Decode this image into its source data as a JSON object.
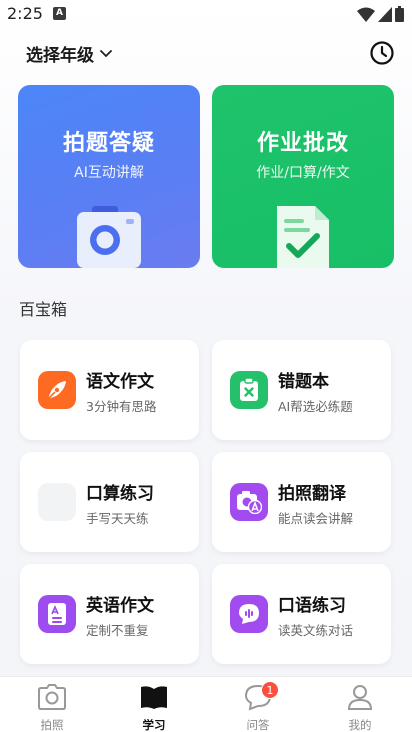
{
  "status_bar": {
    "time": "2:25",
    "app_indicator": "A"
  },
  "header": {
    "grade_label": "选择年级",
    "history_icon": "clock-icon"
  },
  "hero_cards": [
    {
      "title": "拍题答疑",
      "subtitle": "AI互动讲解",
      "color": "#5b7ef4",
      "icon": "camera-icon"
    },
    {
      "title": "作业批改",
      "subtitle": "作业/口算/作文",
      "color": "#1ac168",
      "icon": "checklist-icon"
    }
  ],
  "section": {
    "title": "百宝箱"
  },
  "tools": [
    {
      "name": "语文作文",
      "desc": "3分钟有思路",
      "icon": "pen-nib-icon",
      "color": "#ff6a22"
    },
    {
      "name": "错题本",
      "desc": "AI帮选必练题",
      "icon": "clipboard-x-icon",
      "color": "#24c06a"
    },
    {
      "name": "口算练习",
      "desc": "手写天天练",
      "icon": "placeholder-icon",
      "color": "#f2f3f5"
    },
    {
      "name": "拍照翻译",
      "desc": "能点读会讲解",
      "icon": "camera-translate-icon",
      "color": "#a24cf0"
    },
    {
      "name": "英语作文",
      "desc": "定制不重复",
      "icon": "document-a-icon",
      "color": "#9d4cf0"
    },
    {
      "name": "口语练习",
      "desc": "读英文练对话",
      "icon": "speech-bubble-icon",
      "color": "#a24cf0"
    }
  ],
  "nav": {
    "items": [
      {
        "label": "拍照",
        "icon": "camera-icon"
      },
      {
        "label": "学习",
        "icon": "book-icon",
        "active": true
      },
      {
        "label": "问答",
        "icon": "chat-icon",
        "badge": "1"
      },
      {
        "label": "我的",
        "icon": "user-icon"
      }
    ]
  }
}
